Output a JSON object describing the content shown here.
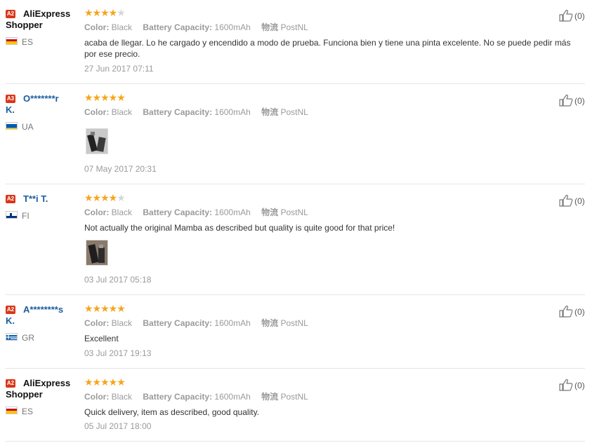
{
  "reviews": [
    {
      "badge": "A2",
      "user_line1": "AliExpress",
      "user_line2": "Shopper",
      "country": "ES",
      "rating": 4,
      "color_label": "Color:",
      "color_value": "Black",
      "capacity_label": "Battery Capacity:",
      "capacity_value": "1600mAh",
      "ship_label": "物流",
      "ship_value": "PostNL",
      "text": "acaba de llegar. Lo he cargado y encendido a modo de prueba. Funciona bien y tiene una pinta excelente. No se puede pedir más por ese precio.",
      "date": "27 Jun 2017 07:11",
      "helpful": "(0)"
    },
    {
      "badge": "A3",
      "user_line1": "O*******r",
      "user_line2": "K.",
      "country": "UA",
      "rating": 5,
      "color_label": "Color:",
      "color_value": "Black",
      "capacity_label": "Battery Capacity:",
      "capacity_value": "1600mAh",
      "ship_label": "物流",
      "ship_value": "PostNL",
      "text": "",
      "date": "07 May 2017 20:31",
      "helpful": "(0)"
    },
    {
      "badge": "A2",
      "user_line1": "T**i T.",
      "user_line2": "",
      "country": "FI",
      "rating": 4,
      "color_label": "Color:",
      "color_value": "Black",
      "capacity_label": "Battery Capacity:",
      "capacity_value": "1600mAh",
      "ship_label": "物流",
      "ship_value": "PostNL",
      "text": "Not actually the original Mamba as described but quality is quite good for that price!",
      "date": "03 Jul 2017 05:18",
      "helpful": "(0)"
    },
    {
      "badge": "A2",
      "user_line1": "A********s",
      "user_line2": "K.",
      "country": "GR",
      "rating": 5,
      "color_label": "Color:",
      "color_value": "Black",
      "capacity_label": "Battery Capacity:",
      "capacity_value": "1600mAh",
      "ship_label": "物流",
      "ship_value": "PostNL",
      "text": "Excellent",
      "date": "03 Jul 2017 19:13",
      "helpful": "(0)"
    },
    {
      "badge": "A2",
      "user_line1": "AliExpress",
      "user_line2": "Shopper",
      "country": "ES",
      "rating": 5,
      "color_label": "Color:",
      "color_value": "Black",
      "capacity_label": "Battery Capacity:",
      "capacity_value": "1600mAh",
      "ship_label": "物流",
      "ship_value": "PostNL",
      "text": "Quick delivery, item as described, good quality.",
      "date": "05 Jul 2017 18:00",
      "helpful": "(0)"
    }
  ],
  "colors": {
    "badge": "#d9361b",
    "star": "#f6a51b",
    "username_link": "#1a5c9e"
  }
}
